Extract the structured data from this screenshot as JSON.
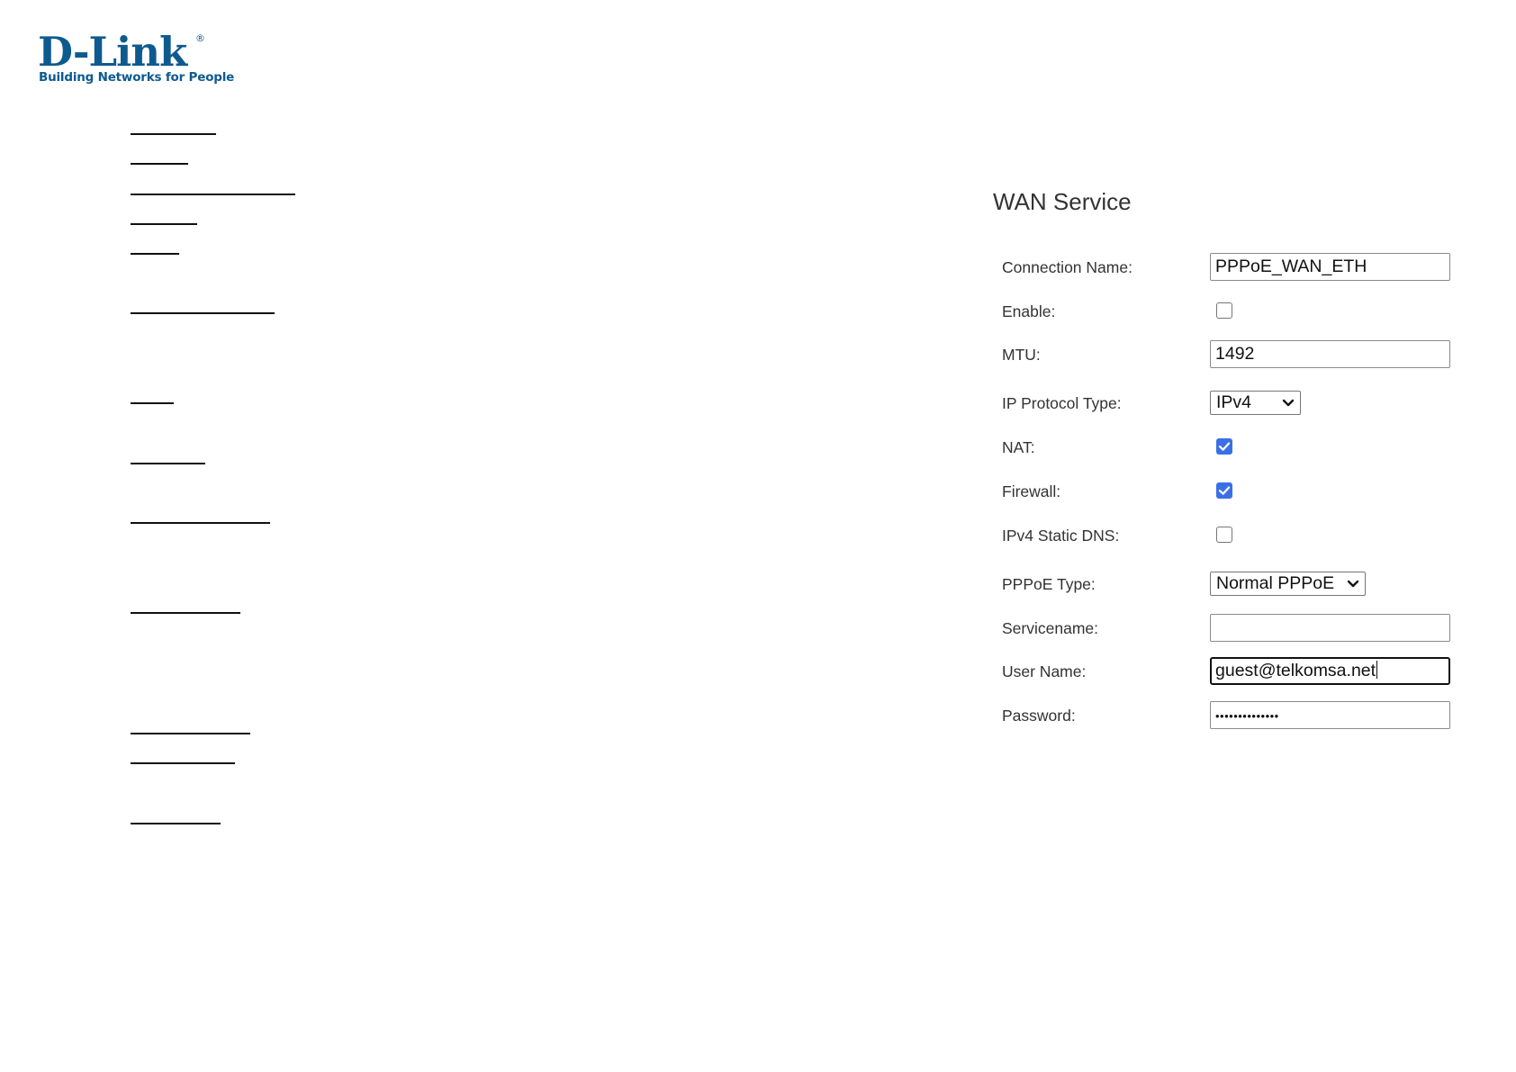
{
  "colors": {
    "brand": "#0d5a8f",
    "checkbox_checked": "#3b6fe6"
  },
  "logo": {
    "wordmark": "D-Link",
    "registered_mark": "®",
    "tagline": "Building Networks for People"
  },
  "panel": {
    "title": "WAN Service"
  },
  "form": {
    "connection_name": {
      "label": "Connection Name:",
      "value": "PPPoE_WAN_ETH"
    },
    "enable": {
      "label": "Enable:",
      "checked": false
    },
    "mtu": {
      "label": "MTU:",
      "value": "1492"
    },
    "ip_protocol_type": {
      "label": "IP Protocol Type:",
      "selected": "IPv4"
    },
    "nat": {
      "label": "NAT:",
      "checked": true
    },
    "firewall": {
      "label": "Firewall:",
      "checked": true
    },
    "ipv4_static_dns": {
      "label": "IPv4 Static DNS:",
      "checked": false
    },
    "pppoe_type": {
      "label": "PPPoE Type:",
      "selected": "Normal PPPoE"
    },
    "servicename": {
      "label": "Servicename:",
      "value": ""
    },
    "user_name": {
      "label": "User Name:",
      "value": "guest@telkomsa.net"
    },
    "password": {
      "label": "Password:",
      "masked_value": "••••••••••••••"
    }
  }
}
